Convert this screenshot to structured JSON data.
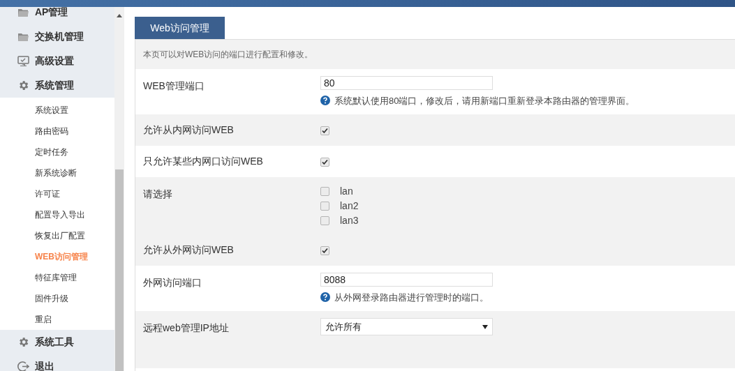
{
  "sidebar": {
    "items": [
      {
        "label": "AP管理",
        "selected": false
      },
      {
        "label": "交换机管理",
        "selected": false
      },
      {
        "label": "高级设置",
        "selected": false
      },
      {
        "label": "系统管理",
        "selected": false,
        "expanded": true,
        "children": [
          {
            "label": "系统设置",
            "selected": false
          },
          {
            "label": "路由密码",
            "selected": false
          },
          {
            "label": "定时任务",
            "selected": false
          },
          {
            "label": "新系统诊断",
            "selected": false
          },
          {
            "label": "许可证",
            "selected": false
          },
          {
            "label": "配置导入导出",
            "selected": false
          },
          {
            "label": "恢复出厂配置",
            "selected": false
          },
          {
            "label": "WEB访问管理",
            "selected": true
          },
          {
            "label": "特征库管理",
            "selected": false
          },
          {
            "label": "固件升级",
            "selected": false
          },
          {
            "label": "重启",
            "selected": false
          }
        ]
      },
      {
        "label": "系统工具",
        "selected": false
      },
      {
        "label": "退出",
        "selected": false
      }
    ]
  },
  "tab": {
    "label": "Web访问管理",
    "selected": true
  },
  "description": "本页可以对WEB访问的端口进行配置和修改。",
  "form": {
    "rows": [
      {
        "kind": "text",
        "label": "WEB管理端口",
        "value": "80",
        "hint": "系统默认使用80端口，修改后，请用新端口重新登录本路由器的管理界面。",
        "shaded": false
      },
      {
        "kind": "checkbox",
        "label": "允许从内网访问WEB",
        "checked": true,
        "shaded": true
      },
      {
        "kind": "checkbox",
        "label": "只允许某些内网口访问WEB",
        "checked": true,
        "shaded": false
      },
      {
        "kind": "checklist",
        "label": "请选择",
        "options": [
          {
            "label": "lan",
            "checked": false
          },
          {
            "label": "lan2",
            "checked": false
          },
          {
            "label": "lan3",
            "checked": false
          }
        ],
        "shaded": true
      },
      {
        "kind": "checkbox",
        "label": "允许从外网访问WEB",
        "checked": true,
        "shaded": true
      },
      {
        "kind": "text",
        "label": "外网访问端口",
        "value": "8088",
        "hint": "从外网登录路由器进行管理时的端口。",
        "shaded": false
      },
      {
        "kind": "select",
        "label": "远程web管理IP地址",
        "value": "允许所有",
        "shaded": true
      }
    ]
  }
}
